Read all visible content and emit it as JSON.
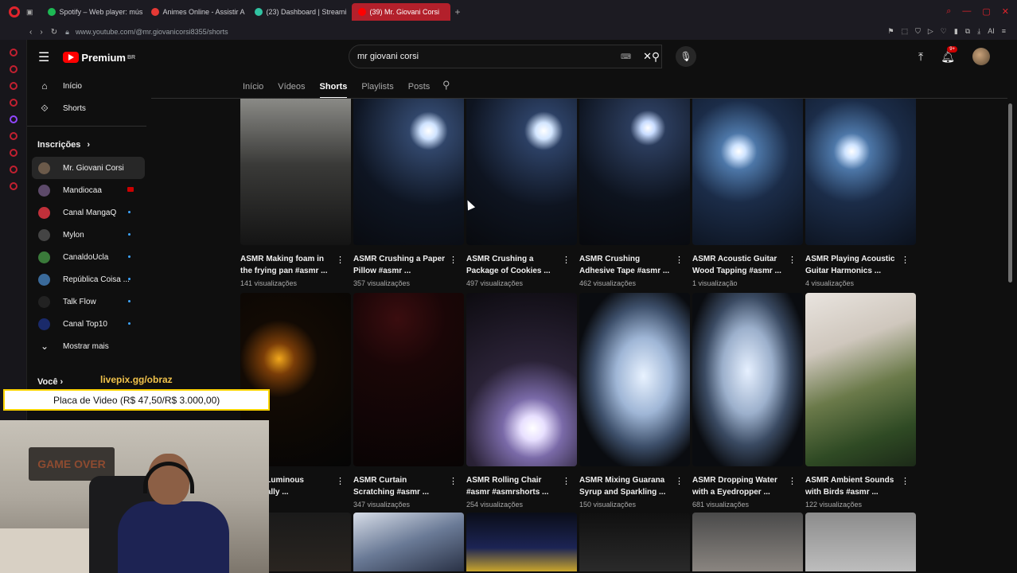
{
  "browser": {
    "tabs": [
      {
        "label": "Spotify – Web player: mús",
        "icon": "spotify-icon",
        "color": "#1db954"
      },
      {
        "label": "Animes Online - Assistir A",
        "icon": "animes-icon",
        "color": "#e53935"
      },
      {
        "label": "(23) Dashboard | Streami",
        "icon": "streamlabs-icon",
        "color": "#31c3a2"
      },
      {
        "label": "(39) Mr. Giovani Corsi",
        "icon": "youtube-icon",
        "color": "#ff0000",
        "active": true
      }
    ],
    "new_tab": "+",
    "url": "www.youtube.com/@mr.giovanicorsi8355/shorts",
    "ai_label": "AI"
  },
  "header": {
    "logo_text": "Premium",
    "logo_region": "BR",
    "search_value": "mr giovani corsi",
    "notifications_badge": "9+"
  },
  "sidebar": {
    "top_items": [
      {
        "label": "Início",
        "icon": "home-icon"
      },
      {
        "label": "Shorts",
        "icon": "shorts-icon"
      }
    ],
    "subscriptions_title": "Inscrições",
    "subscriptions": [
      {
        "label": "Mr. Giovani Corsi",
        "color": "#6b5a4a",
        "selected": true,
        "status": ""
      },
      {
        "label": "Mandiocaa",
        "color": "#5d4a6a",
        "status": "live"
      },
      {
        "label": "Canal MangaQ",
        "color": "#c0303a",
        "status": "dot"
      },
      {
        "label": "Mylon",
        "color": "#444444",
        "status": "dot"
      },
      {
        "label": "CanaldoUcla",
        "color": "#3a7a3a",
        "status": "dot"
      },
      {
        "label": "República Coisa ...",
        "color": "#3a6a9a",
        "status": "dot"
      },
      {
        "label": "Talk Flow",
        "color": "#222222",
        "status": "dot"
      },
      {
        "label": "Canal Top10",
        "color": "#1a2a6a",
        "status": "dot"
      }
    ],
    "show_more": "Mostrar mais",
    "you_label": "Você"
  },
  "channel_tabs": [
    "Início",
    "Vídeos",
    "Shorts",
    "Playlists",
    "Posts"
  ],
  "active_tab": "Shorts",
  "shorts": [
    {
      "title": "ASMR Making foam in the frying pan #asmr ...",
      "views": "141 visualizações",
      "bg": "linear-gradient(180deg,#8a8a86 0%,#3a3a38 45%,#141414 100%)"
    },
    {
      "title": "ASMR Crushing a Paper Pillow #asmr ...",
      "views": "357 visualizações",
      "bg": "radial-gradient(circle at 68% 22%,#ffffff 0,#cfe3ff 6%,#31466a 14%,#0e1522 55%,#090b10 100%)"
    },
    {
      "title": "ASMR Crushing a Package of Cookies ...",
      "views": "497 visualizações",
      "bg": "radial-gradient(circle at 70% 22%,#ffffff 0,#d3e6ff 6%,#2c4064 14%,#0e1420 55%,#080a0e 100%)"
    },
    {
      "title": "ASMR Crushing Adhesive Tape #asmr ...",
      "views": "462 visualizações",
      "bg": "radial-gradient(circle at 62% 20%,#ffffff 0,#c8dcff 5%,#2b3c5c 13%,#0d131e 55%,#08090d 100%)"
    },
    {
      "title": "ASMR Acoustic Guitar Wood Tapping #asmr ...",
      "views": "1 visualização",
      "bg": "radial-gradient(circle at 42% 36%,#ffffff 0,#cfe4ff 6%,#4d77a8 16%,#1b2c48 45%,#0b111c 100%)"
    },
    {
      "title": "ASMR Playing Acoustic Guitar Harmonics ...",
      "views": "4 visualizações",
      "bg": "radial-gradient(circle at 42% 36%,#ffffff 0,#cfe4ff 6%,#4d77a8 16%,#1b2c48 45%,#0b111c 100%)"
    },
    {
      "title": "ASMR Luminous (Originally ...",
      "views": "...",
      "bg": "radial-gradient(circle at 35% 38%,#f2a81c 0,#7a3d08 12%,#120a04 30%,#050505 100%)"
    },
    {
      "title": "ASMR Curtain Scratching #asmr ...",
      "views": "347 visualizações",
      "bg": "radial-gradient(circle at 40% 15%,#3a0d0f 0,#1a0607 30%,#080404 100%)"
    },
    {
      "title": "ASMR Rolling Chair #asmr #asmrshorts ...",
      "views": "254 visualizações",
      "bg": "radial-gradient(circle at 60% 78%,#ffffff 0,#e8e0ff 8%,#7a6aa8 20%,#2a2236 45%,#0d0b10 100%)"
    },
    {
      "title": "ASMR Mixing Guarana Syrup and Sparkling ...",
      "views": "150 visualizações",
      "bg": "radial-gradient(ellipse at 58% 48%,#e8f2ff 0,#9fb6d6 30%,#3d4f6a 55%,#0a0c10 75%)"
    },
    {
      "title": "ASMR Dropping Water with a Eyedropper ...",
      "views": "681 visualizações",
      "bg": "radial-gradient(ellipse at 50% 45%,#e6f0ff 0,#9cb0cc 32%,#3a4a62 55%,#0a0c10 78%)"
    },
    {
      "title": "ASMR Ambient Sounds with Birds #asmr ...",
      "views": "122 visualizações",
      "bg": "linear-gradient(160deg,#e9e4df 0%,#cfc7bd 30%,#6b7a4a 55%,#2f4a24 80%,#1c2a18 100%)"
    },
    {
      "title": "",
      "views": "",
      "bg": "linear-gradient(180deg,#1a1a1a,#2a2520)"
    },
    {
      "title": "",
      "views": "",
      "bg": "linear-gradient(160deg,#d7dde8,#6a7a96 50%,#2a3246)"
    },
    {
      "title": "",
      "views": "",
      "bg": "linear-gradient(180deg,#0a0d18,#1c2454 60%,#c9a52c)"
    },
    {
      "title": "",
      "views": "",
      "bg": "linear-gradient(180deg,#101010,#2a2a2a)"
    },
    {
      "title": "",
      "views": "",
      "bg": "linear-gradient(180deg,#4a4a4a,#8a8580)"
    },
    {
      "title": "",
      "views": "",
      "bg": "linear-gradient(180deg,#8c8c8c,#bdbdbd)"
    }
  ],
  "stream_overlay": {
    "link": "livepix.gg/obraz",
    "donation": "Placa de Video (R$ 47,50/R$ 3.000,00)",
    "sign_text": "GAME OVER"
  }
}
